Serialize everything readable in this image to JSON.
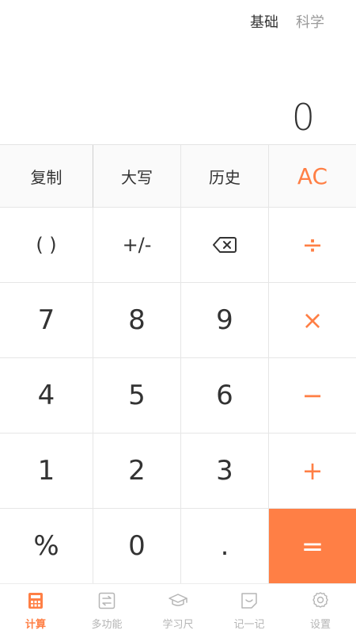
{
  "mode_tabs": {
    "basic": "基础",
    "science": "科学"
  },
  "display": {
    "value": "0"
  },
  "keys": {
    "row1": [
      "复制",
      "大写",
      "历史",
      "AC"
    ],
    "row2": [
      "( )",
      "+/-",
      "",
      "÷"
    ],
    "row3": [
      "7",
      "8",
      "9",
      "×"
    ],
    "row4": [
      "4",
      "5",
      "6",
      "−"
    ],
    "row5": [
      "1",
      "2",
      "3",
      "+"
    ],
    "row6": [
      "%",
      "0",
      ".",
      "="
    ]
  },
  "icons": {
    "backspace": "backspace-icon",
    "calculator": "calculator-icon",
    "multi_function": "convert-icon",
    "study_ruler": "graduation-cap-icon",
    "notes": "note-icon",
    "settings": "gear-icon"
  },
  "tabbar": {
    "items": [
      {
        "label": "计算"
      },
      {
        "label": "多功能"
      },
      {
        "label": "学习尺"
      },
      {
        "label": "记一记"
      },
      {
        "label": "设置"
      }
    ]
  },
  "colors": {
    "accent": "#ff7f45",
    "text": "#333333",
    "muted": "#b5b5b5"
  }
}
